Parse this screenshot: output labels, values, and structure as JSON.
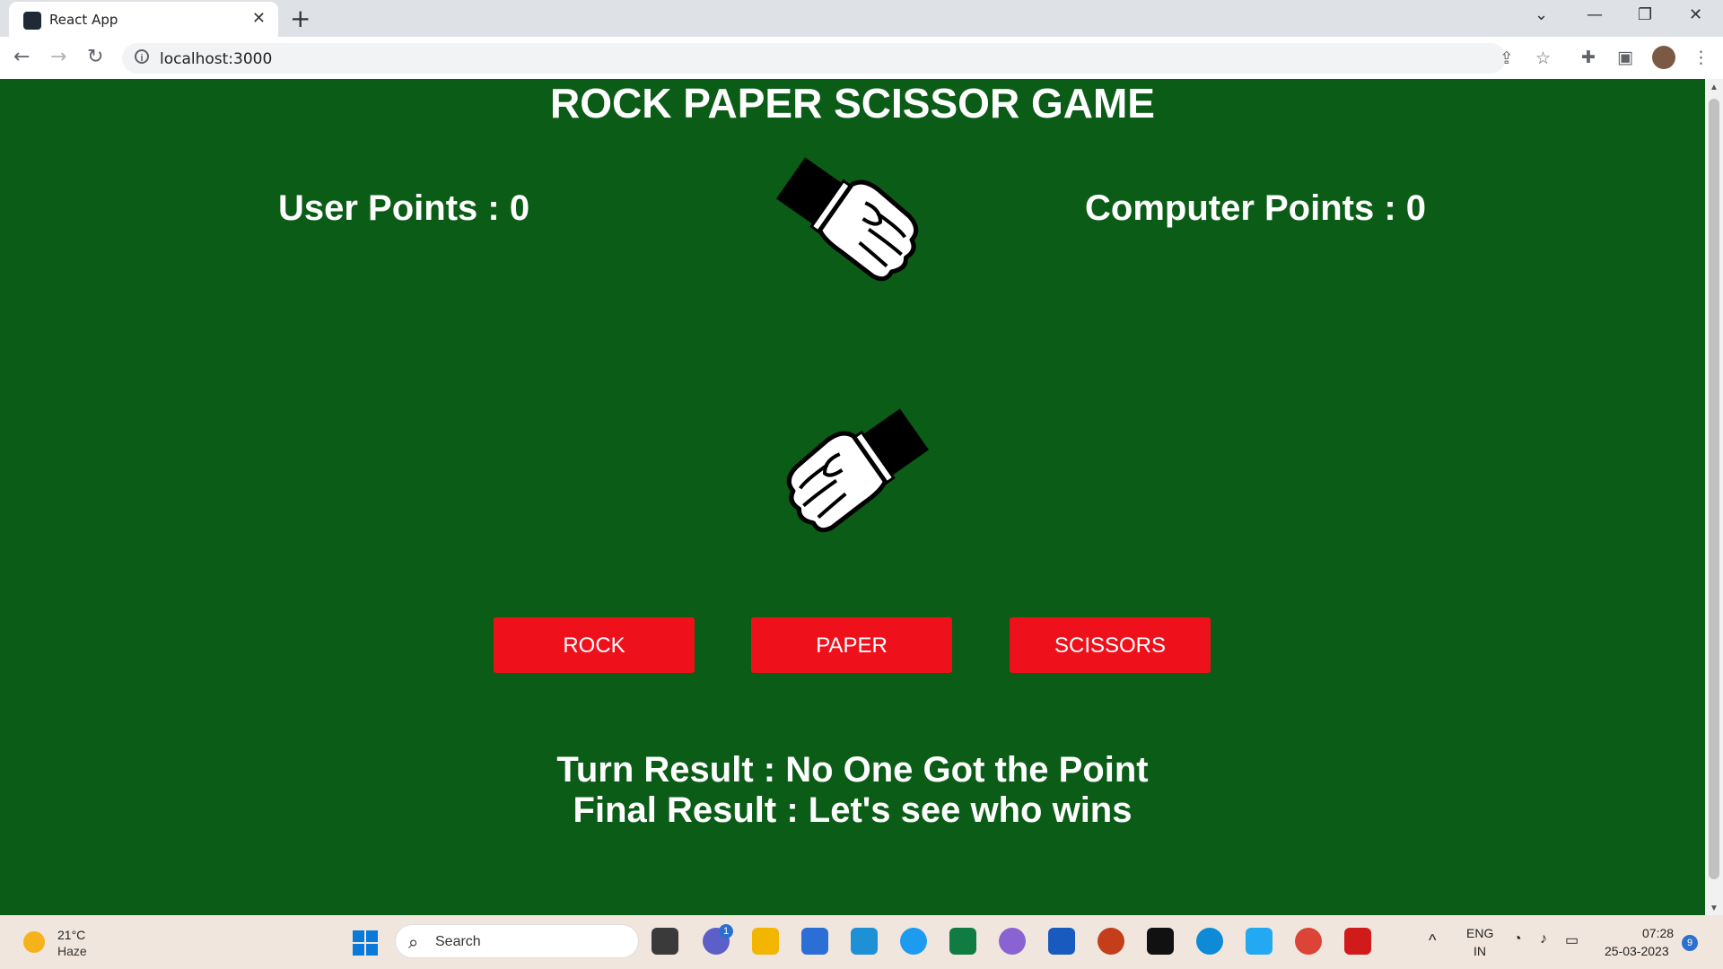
{
  "browser": {
    "tab_title": "React App",
    "url": "localhost:3000"
  },
  "game": {
    "title": "ROCK PAPER SCISSOR GAME",
    "user_points_label": "User Points : 0",
    "computer_points_label": "Computer Points : 0",
    "computer_choice": "rock",
    "user_choice": "rock",
    "buttons": {
      "rock": "ROCK",
      "paper": "PAPER",
      "scissors": "SCISSORS"
    },
    "turn_result": "Turn Result : No One Got the Point",
    "final_result": "Final Result : Let's see who wins"
  },
  "colors": {
    "background": "#0b5c17",
    "button": "#ee111c",
    "text": "#ffffff"
  },
  "taskbar": {
    "weather_temp": "21°C",
    "weather_cond": "Haze",
    "search_placeholder": "Search",
    "chat_badge": "1",
    "lang_top": "ENG",
    "lang_bottom": "IN",
    "time": "07:28",
    "date": "25-03-2023",
    "notif_count": "9"
  }
}
